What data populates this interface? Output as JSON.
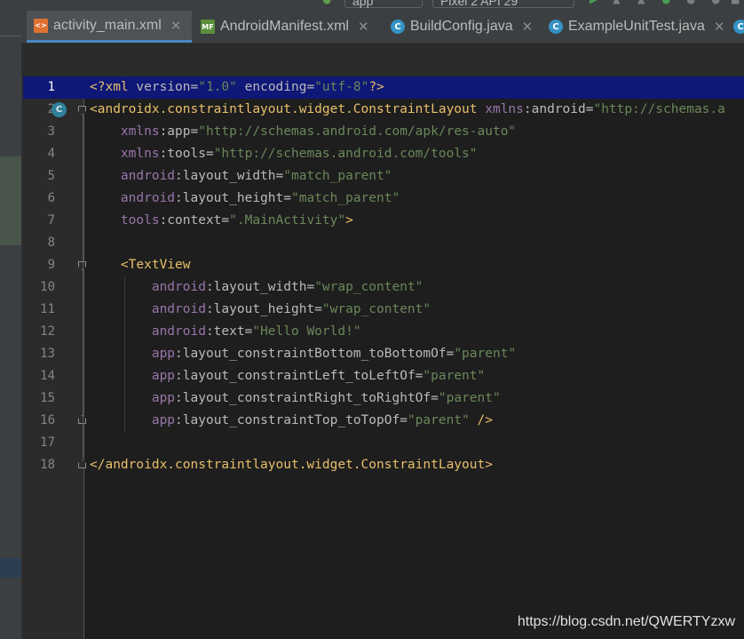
{
  "toolbar": {
    "module_selector": "app",
    "device_selector": "Pixel 2 API 29"
  },
  "tabs": [
    {
      "label": "activity_main.xml",
      "icon": "xml-file-icon",
      "active": true
    },
    {
      "label": "AndroidManifest.xml",
      "icon": "manifest-file-icon",
      "active": false
    },
    {
      "label": "BuildConfig.java",
      "icon": "java-class-icon",
      "active": false
    },
    {
      "label": "ExampleUnitTest.java",
      "icon": "java-class-icon",
      "active": false
    }
  ],
  "editor": {
    "current_line": 1,
    "line_numbers": [
      "1",
      "2",
      "3",
      "4",
      "5",
      "6",
      "7",
      "8",
      "9",
      "10",
      "11",
      "12",
      "13",
      "14",
      "15",
      "16",
      "17",
      "18"
    ],
    "lines": [
      "<?xml version=\"1.0\" encoding=\"utf-8\"?>",
      "<androidx.constraintlayout.widget.ConstraintLayout xmlns:android=\"http://schemas.a",
      "    xmlns:app=\"http://schemas.android.com/apk/res-auto\"",
      "    xmlns:tools=\"http://schemas.android.com/tools\"",
      "    android:layout_width=\"match_parent\"",
      "    android:layout_height=\"match_parent\"",
      "    tools:context=\".MainActivity\">",
      "",
      "    <TextView",
      "        android:layout_width=\"wrap_content\"",
      "        android:layout_height=\"wrap_content\"",
      "        android:text=\"Hello World!\"",
      "        app:layout_constraintBottom_toBottomOf=\"parent\"",
      "        app:layout_constraintLeft_toLeftOf=\"parent\"",
      "        app:layout_constraintRight_toRightOf=\"parent\"",
      "        app:layout_constraintTop_toTopOf=\"parent\" />",
      "",
      "</androidx.constraintlayout.widget.ConstraintLayout>"
    ],
    "gutter_badge": "C"
  },
  "watermark": "https://blog.csdn.net/QWERTYzxw",
  "colors": {
    "tag": "#e8bf6a",
    "namespace": "#9876aa",
    "attribute": "#bababa",
    "value": "#6a8759",
    "current_line_bg": "#0f1777",
    "active_tab_underline": "#4a88c7"
  }
}
